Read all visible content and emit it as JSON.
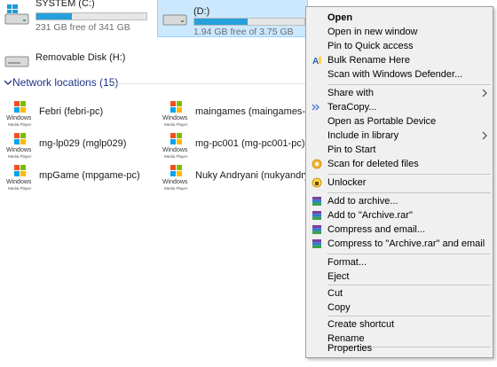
{
  "drives": [
    {
      "name": "SYSTEM (C:)",
      "space": "231 GB free of 341 GB",
      "used_fraction": 0.32,
      "selected": false,
      "icon": "windows-drive-icon"
    },
    {
      "name": "(D:)",
      "space": "1.94 GB free of 3.75 GB",
      "used_fraction": 0.48,
      "selected": true,
      "icon": "hard-drive-icon"
    },
    {
      "name": "Removable Disk (H:)",
      "space": "",
      "selected": false,
      "icon": "removable-disk-icon"
    }
  ],
  "network": {
    "header": "Network locations (15)",
    "items": [
      {
        "label": "Febri (febri-pc)",
        "icon": "windows-media-player-icon",
        "icon_text": [
          "Windows",
          "Media Player"
        ]
      },
      {
        "label": "maingames (maingames-pc)",
        "icon": "windows-media-player-icon",
        "icon_text": [
          "Windows",
          "Media Player"
        ]
      },
      {
        "label": "mg-lp029 (mglp029)",
        "icon": "windows-media-player-icon",
        "icon_text": [
          "Windows",
          "Media Player"
        ]
      },
      {
        "label": "mg-pc001 (mg-pc001-pc)",
        "icon": "windows-media-player-icon",
        "icon_text": [
          "Windows",
          "Media Player"
        ]
      },
      {
        "label": "mpGame (mpgame-pc)",
        "icon": "windows-media-player-icon",
        "icon_text": [
          "Windows",
          "Media Player"
        ]
      },
      {
        "label": "Nuky Andryani (nukyandryani-pc)",
        "icon": "windows-media-player-icon",
        "icon_text": [
          "Windows",
          "Media Player"
        ]
      }
    ]
  },
  "context_menu": {
    "groups": [
      [
        {
          "label": "Open",
          "bold": true
        },
        {
          "label": "Open in new window"
        },
        {
          "label": "Pin to Quick access"
        },
        {
          "label": "Bulk Rename Here",
          "icon": "bulk-rename-icon"
        },
        {
          "label": "Scan with Windows Defender..."
        }
      ],
      [
        {
          "label": "Share with",
          "submenu": true
        },
        {
          "label": "TeraCopy...",
          "icon": "teracopy-icon"
        },
        {
          "label": "Open as Portable Device"
        },
        {
          "label": "Include in library",
          "submenu": true
        },
        {
          "label": "Pin to Start"
        },
        {
          "label": "Scan for deleted files",
          "icon": "recuva-icon"
        }
      ],
      [
        {
          "label": "Unlocker",
          "icon": "unlocker-icon"
        }
      ],
      [
        {
          "label": "Add to archive...",
          "icon": "winrar-icon"
        },
        {
          "label": "Add to \"Archive.rar\"",
          "icon": "winrar-icon"
        },
        {
          "label": "Compress and email...",
          "icon": "winrar-icon"
        },
        {
          "label": "Compress to \"Archive.rar\" and email",
          "icon": "winrar-icon"
        }
      ],
      [
        {
          "label": "Format..."
        },
        {
          "label": "Eject"
        }
      ],
      [
        {
          "label": "Cut"
        },
        {
          "label": "Copy"
        }
      ],
      [
        {
          "label": "Create shortcut"
        },
        {
          "label": "Rename"
        }
      ],
      [
        {
          "label": "Properties"
        }
      ]
    ]
  },
  "colors": {
    "selection_bg": "#cce8ff",
    "selection_border": "#99d1ff",
    "drive_bar_fill": "#26a0da",
    "section_header": "#1e3287",
    "menu_bg": "#f0f0f0"
  }
}
